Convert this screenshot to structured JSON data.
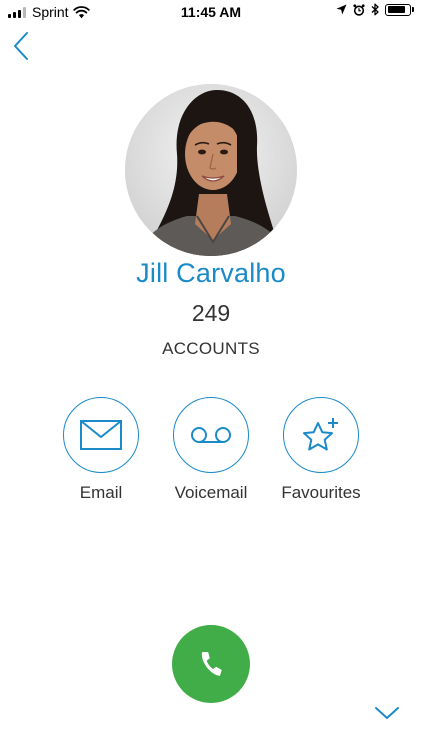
{
  "status_bar": {
    "carrier": "Sprint",
    "time": "11:45 AM",
    "battery_level": 0.85
  },
  "contact": {
    "name": "Jill Carvalho",
    "account_count": "249",
    "account_label": "ACCOUNTS"
  },
  "actions": [
    {
      "label": "Email",
      "icon": "envelope-icon"
    },
    {
      "label": "Voicemail",
      "icon": "voicemail-icon"
    },
    {
      "label": "Favourites",
      "icon": "star-plus-icon"
    }
  ],
  "call": {
    "icon": "phone-icon"
  },
  "colors": {
    "accent": "#1a8ac8",
    "call_green": "#41ad49",
    "text": "#333333"
  }
}
